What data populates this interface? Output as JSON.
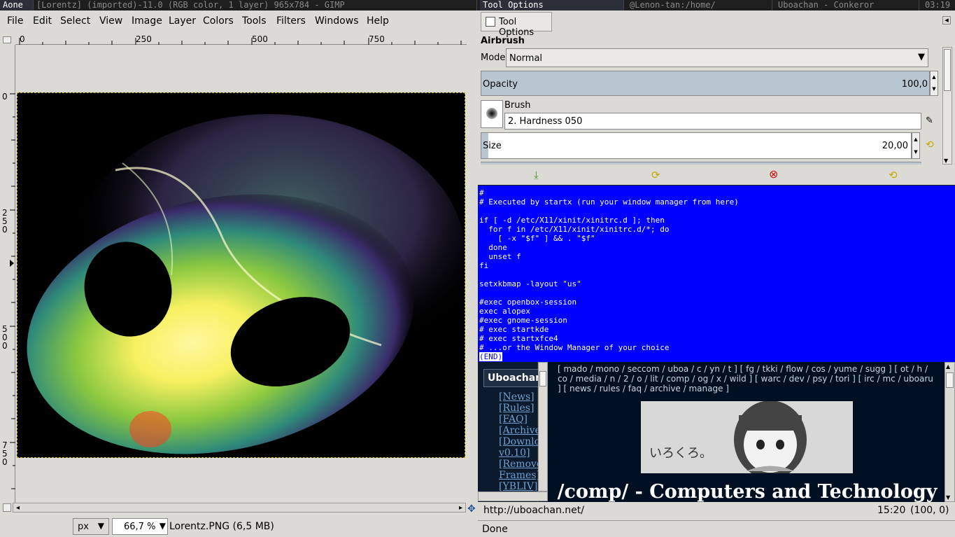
{
  "topbar": {
    "workspace": "Aone",
    "gimp_title": "[Lorentz] (imported)-11.0 (RGB color, 1 layer) 965x784 - GIMP",
    "tool_title": "Tool Options",
    "term_title": "@Lenon-tan:/home/",
    "browser_title": "Uboachan - Conkeror",
    "clock": "03:19"
  },
  "gimp": {
    "menu": [
      "File",
      "Edit",
      "Select",
      "View",
      "Image",
      "Layer",
      "Colors",
      "Tools",
      "Filters",
      "Windows",
      "Help"
    ],
    "hruler": [
      "0",
      "250",
      "500",
      "750"
    ],
    "vruler": [
      "0",
      "2\n5\n0",
      "5\n0\n0",
      "7\n5\n0"
    ],
    "status": {
      "unit": "px",
      "zoom": "66,7 %",
      "file": "Lorentz.PNG (6,5 MB)"
    }
  },
  "tool_options": {
    "tab": "Tool Options",
    "tool": "Airbrush",
    "mode_label": "Mode:",
    "mode_value": "Normal",
    "opacity_label": "Opacity",
    "opacity_value": "100,0",
    "brush_label": "Brush",
    "brush_value": "2. Hardness 050",
    "size_label": "Size",
    "size_value": "20,00"
  },
  "terminal": {
    "lines": [
      "#",
      "# Executed by startx (run your window manager from here)",
      "",
      "if [ -d /etc/X11/xinit/xinitrc.d ]; then",
      "  for f in /etc/X11/xinit/xinitrc.d/*; do",
      "    [ -x \"$f\" ] && . \"$f\"",
      "  done",
      "  unset f",
      "fi",
      "",
      "setxkbmap -layout \"us\"",
      "",
      "#exec openbox-session",
      "exec alopex",
      "#exec gnome-session",
      "# exec startkde",
      "# exec startxfce4",
      "# ...or the Window Manager of your choice"
    ],
    "end_marker": "(END)"
  },
  "browser": {
    "site_title": "Uboachan",
    "side_links": [
      "[News]",
      "[Rules]",
      "[FAQ]",
      "[Archive",
      "[Downlo",
      "v0.10]",
      "[Remove",
      "Frames]",
      "[YBLIV]"
    ],
    "boardnav": "[ mado / mono / seccom / uboa / c / yn / t ] [ fg / tkki / flow / cos / yume / sugg ] [ ot / h / co / media / n / 2 / o / lit / comp / og / x / wild ] [ warc / dev / psy / tori ] [ irc / mc / uboaru ] [ news / rules / faq / archive / manage ]",
    "banner_text": "いろくろ。",
    "board_title": "/comp/ - Computers and Technology",
    "url": "http://uboachan.net/",
    "time": "15:20",
    "coords": "(100, 0)",
    "status": "Done"
  }
}
